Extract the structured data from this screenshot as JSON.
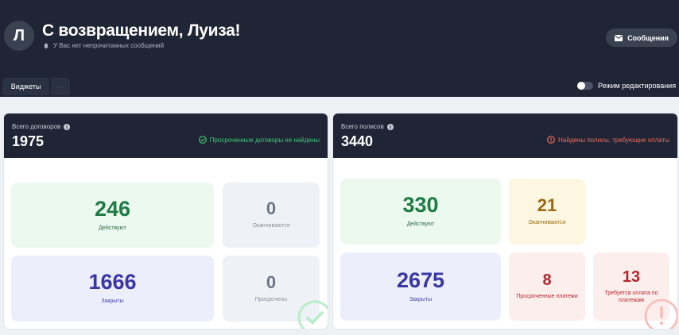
{
  "header": {
    "avatar_letter": "Л",
    "greeting": "С возвращением, Луиза!",
    "notification_text": "У Вас нет непрочитанных сообщений",
    "messages_button": "Сообщения"
  },
  "tabs": [
    {
      "label": "Виджеты",
      "active": true
    },
    {
      "label": "···"
    }
  ],
  "edit_mode": {
    "label": "Режим редактирования",
    "enabled": false
  },
  "contracts": {
    "label": "Всего договоров",
    "total": "1975",
    "status": "Просроченные договоры не найдены",
    "status_color": "#3cc776",
    "cards": [
      {
        "value": "246",
        "label": "Действуют"
      },
      {
        "value": "0",
        "label": "Оканчиваются"
      },
      {
        "value": "1666",
        "label": "Закрыты"
      },
      {
        "value": "0",
        "label": "Просрочены"
      }
    ]
  },
  "policies": {
    "label": "Всего полисов",
    "total": "3440",
    "status": "Найдены полисы, требующие оплаты",
    "status_color": "#f06a5e",
    "cards": [
      {
        "value": "330",
        "label": "Действуют"
      },
      {
        "value": "21",
        "label": "Оканчиваются"
      },
      {
        "value": "2675",
        "label": "Закрыты"
      },
      {
        "value": "8",
        "label": "Просроченные платежи"
      },
      {
        "value": "13",
        "label": "Требуется оплата по платежам"
      }
    ]
  },
  "colors": {
    "header_bg": "#1f2535",
    "page_bg": "#eef1f4",
    "success": "#3cc776",
    "danger": "#f06a5e"
  },
  "icons": [
    "bell-icon",
    "mail-icon",
    "info-icon",
    "check-circle-icon",
    "alert-circle-icon"
  ]
}
